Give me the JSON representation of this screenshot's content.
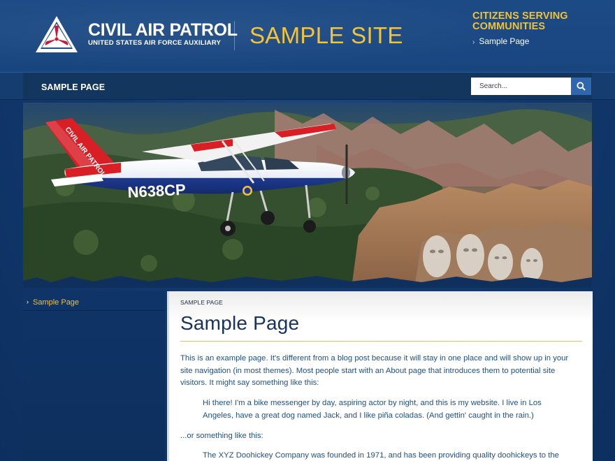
{
  "header": {
    "org_title": "CIVIL AIR PATROL",
    "org_subtitle": "UNITED STATES AIR FORCE AUXILIARY",
    "site_name": "SAMPLE SITE",
    "tagline": "CITIZENS SERVING COMMUNITIES",
    "link": "Sample Page"
  },
  "nav": {
    "items": [
      "SAMPLE PAGE"
    ]
  },
  "search": {
    "placeholder": "Search..."
  },
  "hero": {
    "plane_tail": "CIVIL AIR PATROL",
    "plane_id": "N638CP"
  },
  "sidebar": {
    "items": [
      "Sample Page"
    ]
  },
  "content": {
    "breadcrumb": "SAMPLE PAGE",
    "title": "Sample Page",
    "p1": "This is an example page. It's different from a blog post because it will stay in one place and will show up in your site navigation (in most themes). Most people start with an About page that introduces them to potential site visitors. It might say something like this:",
    "q1": "Hi there! I'm a bike messenger by day, aspiring actor by night, and this is my website. I live in Los Angeles, have a great dog named Jack, and I like piña coladas. (And gettin' caught in the rain.)",
    "p2": "...or something like this:",
    "q2": "The XYZ Doohickey Company was founded in 1971, and has been providing quality doohickeys to the"
  },
  "colors": {
    "brand_blue": "#17325e",
    "accent_gold": "#f2c232",
    "link_blue": "#1f4f8a"
  }
}
